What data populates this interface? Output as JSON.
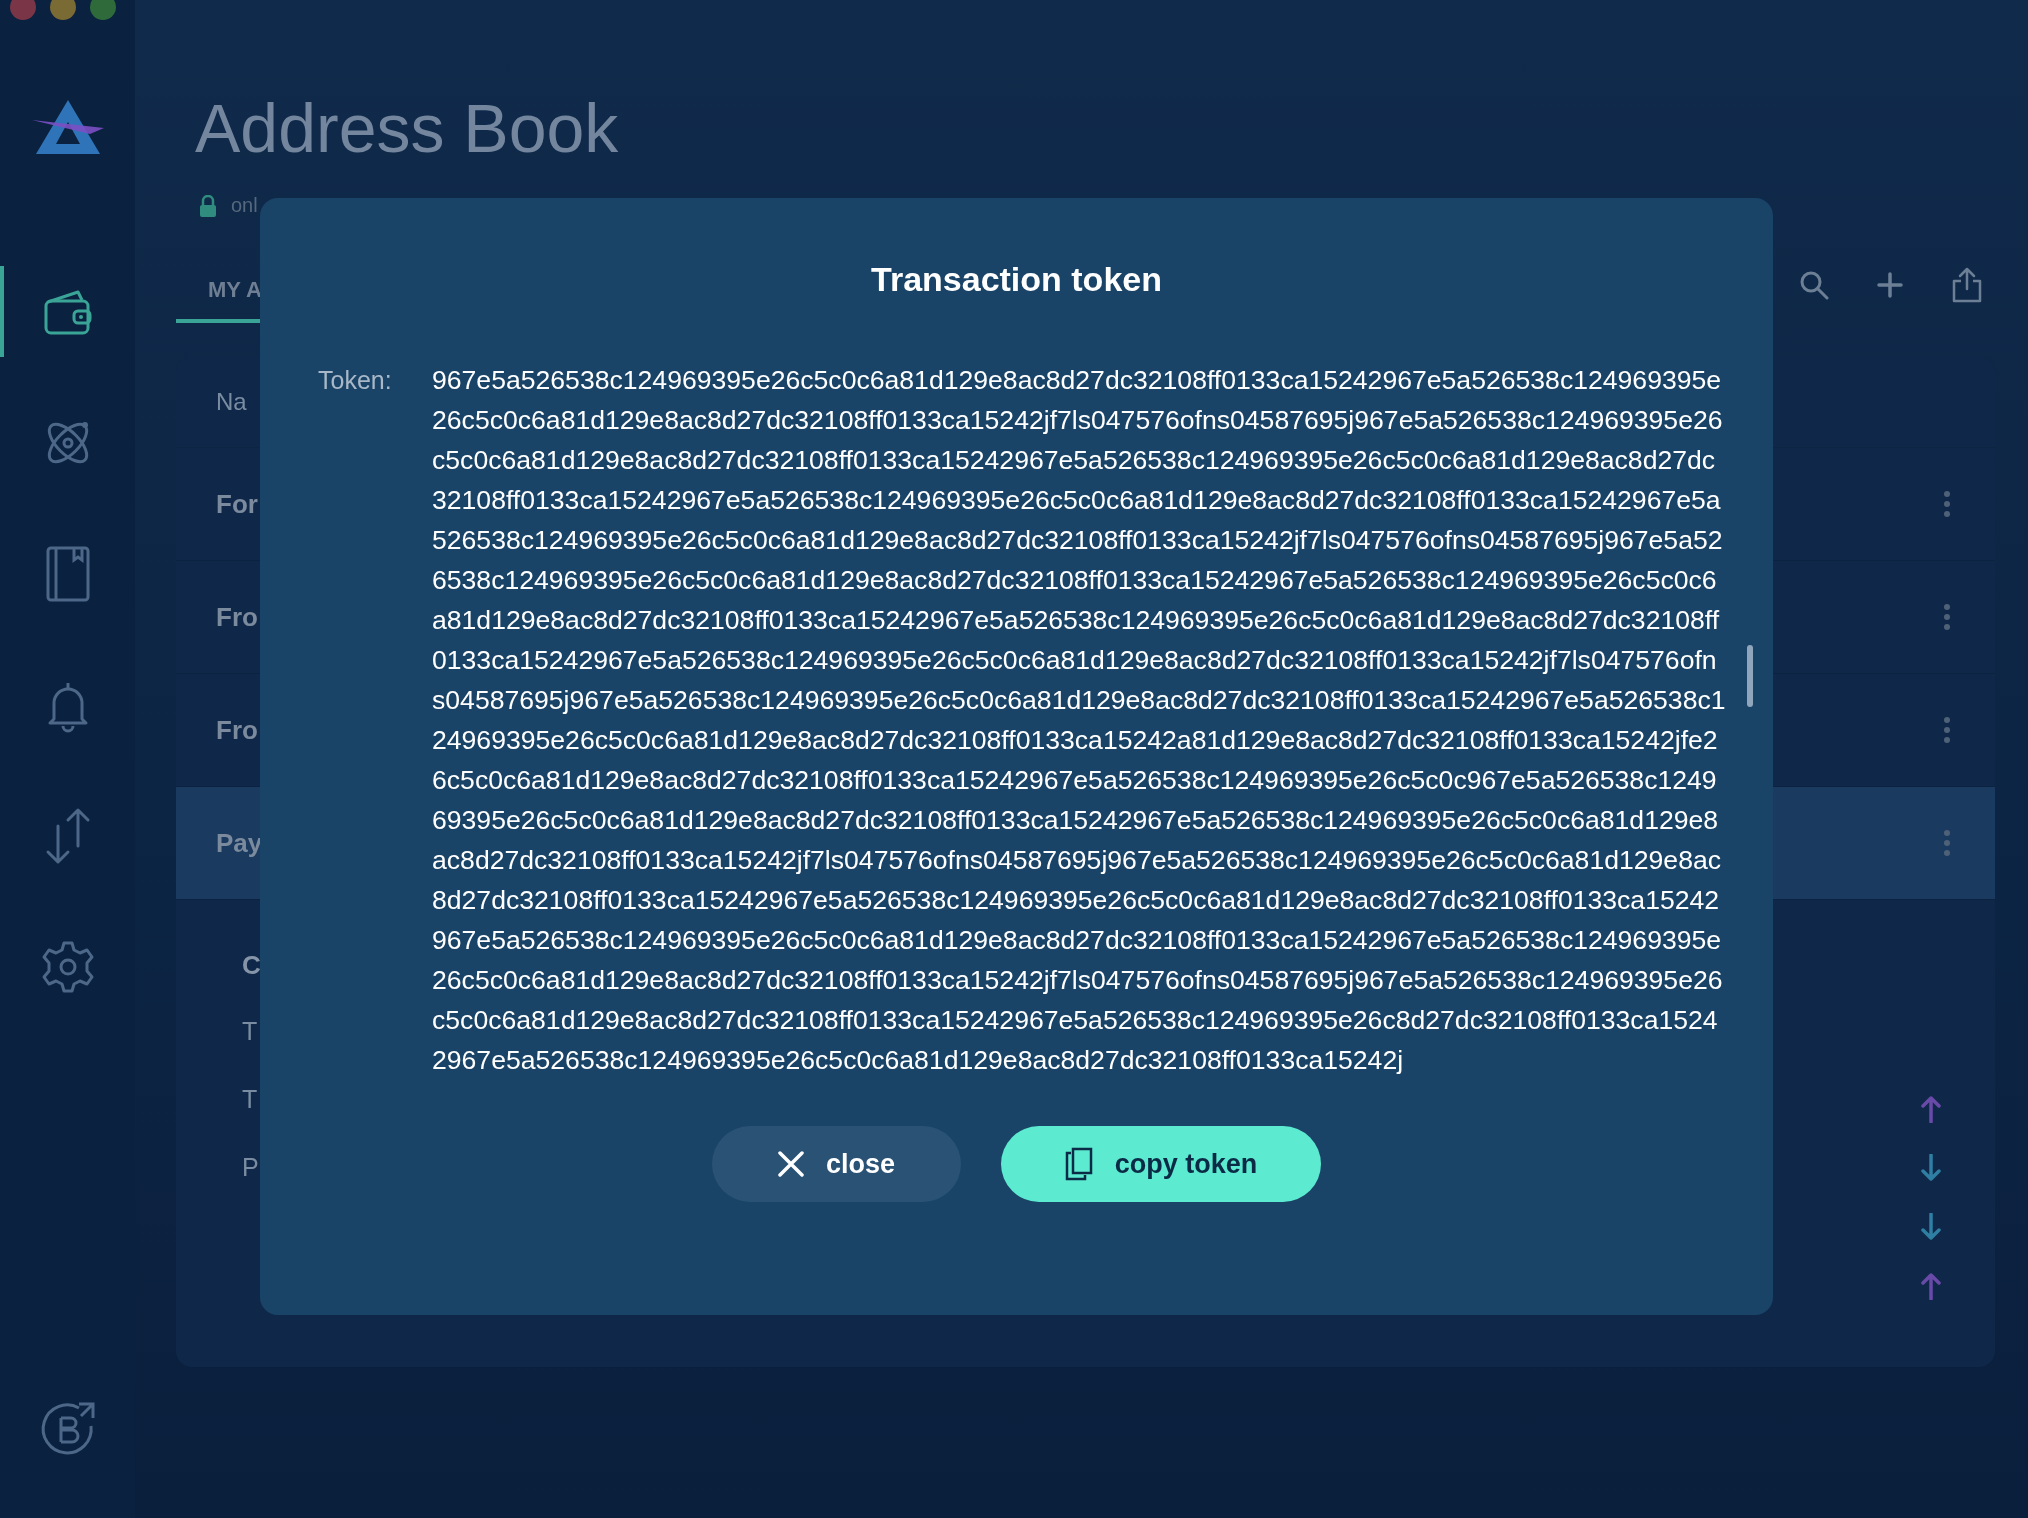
{
  "sidebar": {
    "items": [
      {
        "kind": "wallet",
        "selected": true
      },
      {
        "kind": "atom",
        "selected": false
      },
      {
        "kind": "book",
        "selected": false
      },
      {
        "kind": "bell",
        "selected": false
      },
      {
        "kind": "transfer",
        "selected": false
      },
      {
        "kind": "settings",
        "selected": false
      }
    ]
  },
  "page": {
    "title": "Address Book",
    "status": "onl",
    "tabs": [
      {
        "label": "MY A",
        "selected": true
      }
    ],
    "table": {
      "header": "Na",
      "rows": [
        {
          "name": "For",
          "selected": false
        },
        {
          "name": "Fro",
          "selected": false
        },
        {
          "name": "Fro",
          "selected": false
        },
        {
          "name": "Pay",
          "selected": true
        }
      ]
    },
    "details": {
      "title": "C",
      "fields": [
        "T",
        "T",
        "P"
      ]
    },
    "transfers": [
      {
        "kind": "up"
      },
      {
        "kind": "down"
      },
      {
        "kind": "down"
      },
      {
        "kind": "up"
      }
    ]
  },
  "dialog": {
    "title": "Transaction token",
    "label": "Token:",
    "token": "967e5a526538c124969395e26c5c0c6a81d129e8ac8d27dc32108ff0133ca15242967e5a526538c124969395e26c5c0c6a81d129e8ac8d27dc32108ff0133ca15242jf7ls047576ofns04587695j967e5a526538c124969395e26c5c0c6a81d129e8ac8d27dc32108ff0133ca15242967e5a526538c124969395e26c5c0c6a81d129e8ac8d27dc32108ff0133ca15242967e5a526538c124969395e26c5c0c6a81d129e8ac8d27dc32108ff0133ca15242967e5a526538c124969395e26c5c0c6a81d129e8ac8d27dc32108ff0133ca15242jf7ls047576ofns04587695j967e5a526538c124969395e26c5c0c6a81d129e8ac8d27dc32108ff0133ca15242967e5a526538c124969395e26c5c0c6a81d129e8ac8d27dc32108ff0133ca15242967e5a526538c124969395e26c5c0c6a81d129e8ac8d27dc32108ff0133ca15242967e5a526538c124969395e26c5c0c6a81d129e8ac8d27dc32108ff0133ca15242jf7ls047576ofns04587695j967e5a526538c124969395e26c5c0c6a81d129e8ac8d27dc32108ff0133ca15242967e5a526538c124969395e26c5c0c6a81d129e8ac8d27dc32108ff0133ca15242a81d129e8ac8d27dc32108ff0133ca15242jfe26c5c0c6a81d129e8ac8d27dc32108ff0133ca15242967e5a526538c124969395e26c5c0c967e5a526538c124969395e26c5c0c6a81d129e8ac8d27dc32108ff0133ca15242967e5a526538c124969395e26c5c0c6a81d129e8ac8d27dc32108ff0133ca15242jf7ls047576ofns04587695j967e5a526538c124969395e26c5c0c6a81d129e8ac8d27dc32108ff0133ca15242967e5a526538c124969395e26c5c0c6a81d129e8ac8d27dc32108ff0133ca15242967e5a526538c124969395e26c5c0c6a81d129e8ac8d27dc32108ff0133ca15242967e5a526538c124969395e26c5c0c6a81d129e8ac8d27dc32108ff0133ca15242jf7ls047576ofns04587695j967e5a526538c124969395e26c5c0c6a81d129e8ac8d27dc32108ff0133ca15242967e5a526538c124969395e26c8d27dc32108ff0133ca15242967e5a526538c124969395e26c5c0c6a81d129e8ac8d27dc32108ff0133ca15242j",
    "buttons": [
      {
        "label": "close",
        "kind": "secondary"
      },
      {
        "label": "copy token",
        "kind": "primary"
      }
    ]
  }
}
